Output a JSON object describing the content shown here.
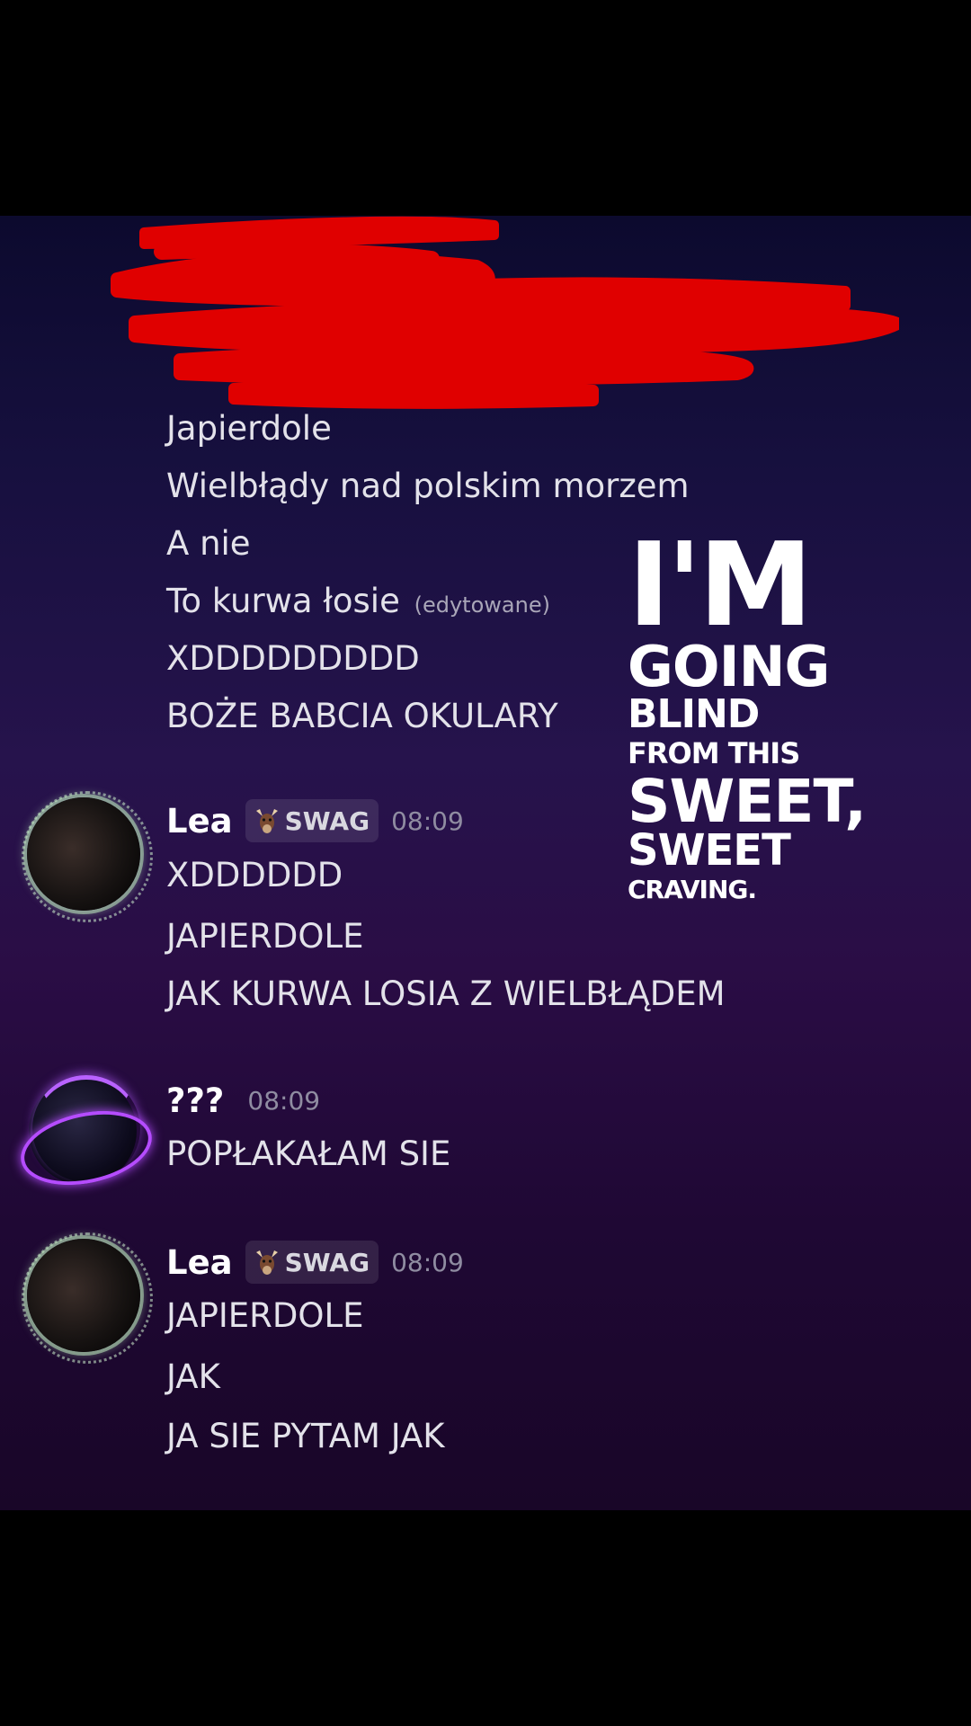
{
  "messages": {
    "line_japierdole": "Japierdole",
    "line_wielblady": "Wielbłądy nad polskim morzem",
    "line_a_nie": "A nie",
    "line_to_kurwa": "To kurwa łosie",
    "edited_label": "(edytowane)",
    "line_xd1": "XDDDDDDDDD",
    "line_boze": "BOŻE BABCIA OKULARY"
  },
  "group1": {
    "author": "Lea",
    "tag": "SWAG",
    "time": "08:09",
    "lines": [
      "XDDDDDD",
      "JAPIERDOLE",
      "JAK KURWA LOSIA Z WIELBŁĄDEM"
    ]
  },
  "group2": {
    "author": "???",
    "time": "08:09",
    "lines": [
      "POPŁAKAŁAM SIE"
    ]
  },
  "group3": {
    "author": "Lea",
    "tag": "SWAG",
    "time": "08:09",
    "lines": [
      "JAPIERDOLE",
      "JAK",
      "JA SIE PYTAM  JAK"
    ]
  },
  "overlay": {
    "line1": "I'M",
    "line2": "GOING",
    "line3": "BLIND",
    "line4": "FROM THIS",
    "line5": "SWEET,",
    "line6": "SWEET",
    "line7": "CRAVING."
  },
  "colors": {
    "redaction": "#e00000",
    "tag_background": "#2e2340",
    "overlay_text": "#ffffff"
  },
  "icons": {
    "tag_icon": "goat-head-icon",
    "redaction": "red-scribble"
  }
}
